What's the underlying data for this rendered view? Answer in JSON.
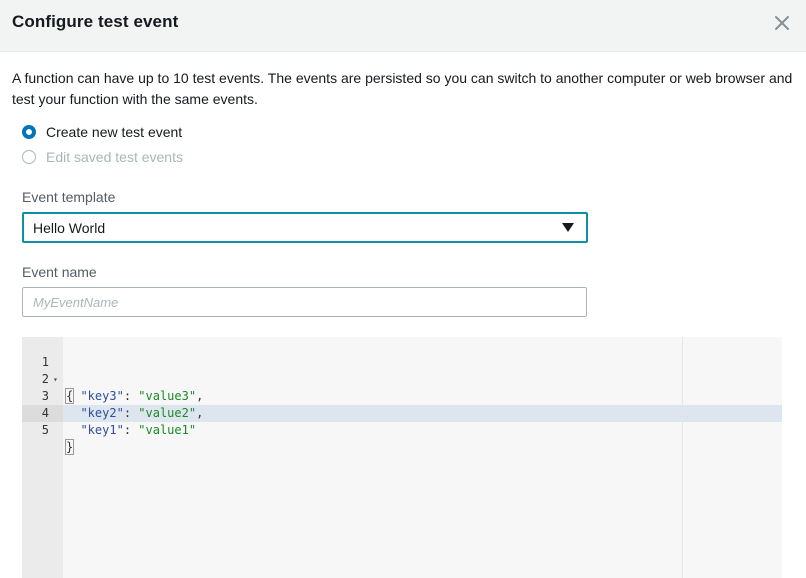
{
  "dialog": {
    "title": "Configure test event",
    "close_icon": "close-icon"
  },
  "description": "A function can have up to 10 test events. The events are persisted so you can switch to another computer or web browser and test your function with the same events.",
  "radio_options": [
    {
      "label": "Create new test event",
      "selected": true,
      "disabled": false
    },
    {
      "label": "Edit saved test events",
      "selected": false,
      "disabled": true
    }
  ],
  "event_template": {
    "label": "Event template",
    "value": "Hello World"
  },
  "event_name": {
    "label": "Event name",
    "value": "",
    "placeholder": "MyEventName"
  },
  "editor": {
    "lines": [
      {
        "number": "1",
        "text": "{"
      },
      {
        "number": "2",
        "key": "\"key3\"",
        "value": "\"value3\"",
        "trailing": ","
      },
      {
        "number": "3",
        "key": "\"key2\"",
        "value": "\"value2\"",
        "trailing": ","
      },
      {
        "number": "4",
        "key": "\"key1\"",
        "value": "\"value1\"",
        "trailing": ""
      },
      {
        "number": "5",
        "text": "}"
      }
    ],
    "active_line": "5"
  },
  "colors": {
    "accent": "#0073bb",
    "select_focus_border": "#0f8fa3",
    "json_key": "#2e4d9e",
    "json_string": "#1a8a24"
  }
}
